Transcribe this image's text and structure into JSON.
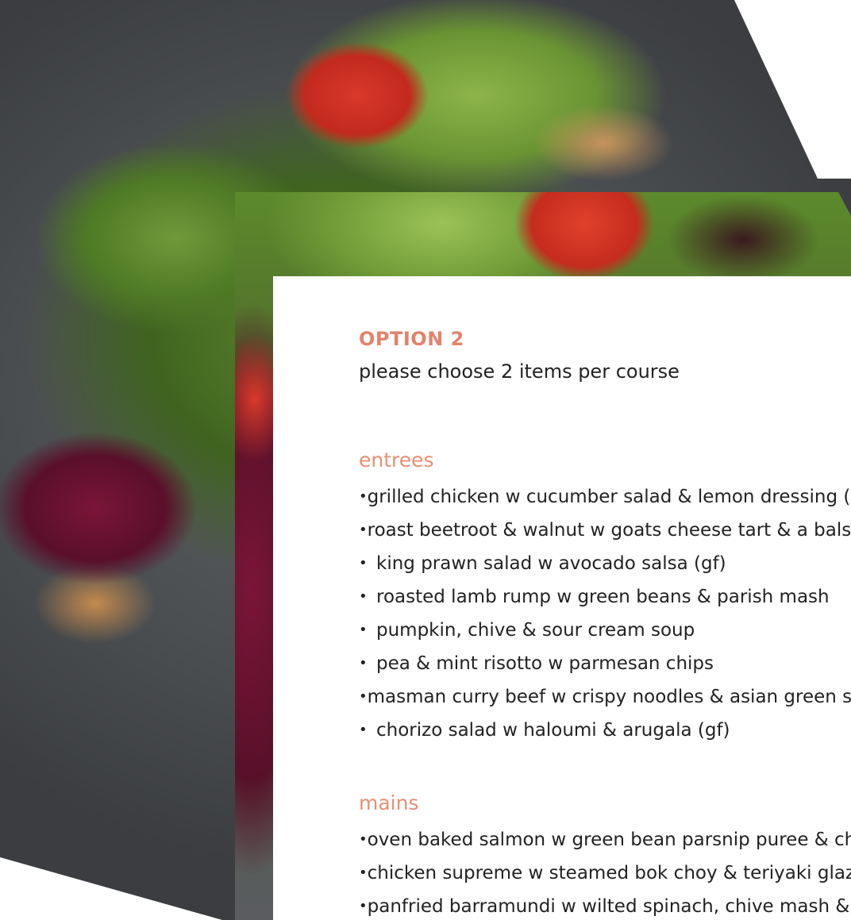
{
  "menu": {
    "title": "OPTION 2",
    "subtitle": "please choose 2 items per course",
    "sections": [
      {
        "heading": "entrees",
        "items": [
          "grilled chicken w cucumber salad & lemon dressing (g",
          "roast beetroot & walnut w goats cheese tart & a balsam",
          "king prawn salad w avocado salsa (gf)",
          "roasted lamb rump w green beans & parish mash",
          "pumpkin, chive & sour cream soup",
          "pea & mint risotto w parmesan chips",
          "masman curry beef w crispy noodles & asian green sal",
          "chorizo salad w haloumi & arugala (gf)"
        ]
      },
      {
        "heading": "mains",
        "items": [
          "oven baked salmon w green bean parsnip puree & chi",
          "chicken supreme w steamed bok choy & teriyaki glaze",
          "panfried barramundi w wilted spinach, chive mash & c"
        ]
      }
    ],
    "bullet": "•"
  },
  "colors": {
    "accent": "#e2836a",
    "text": "#222222",
    "background": "#ffffff"
  }
}
